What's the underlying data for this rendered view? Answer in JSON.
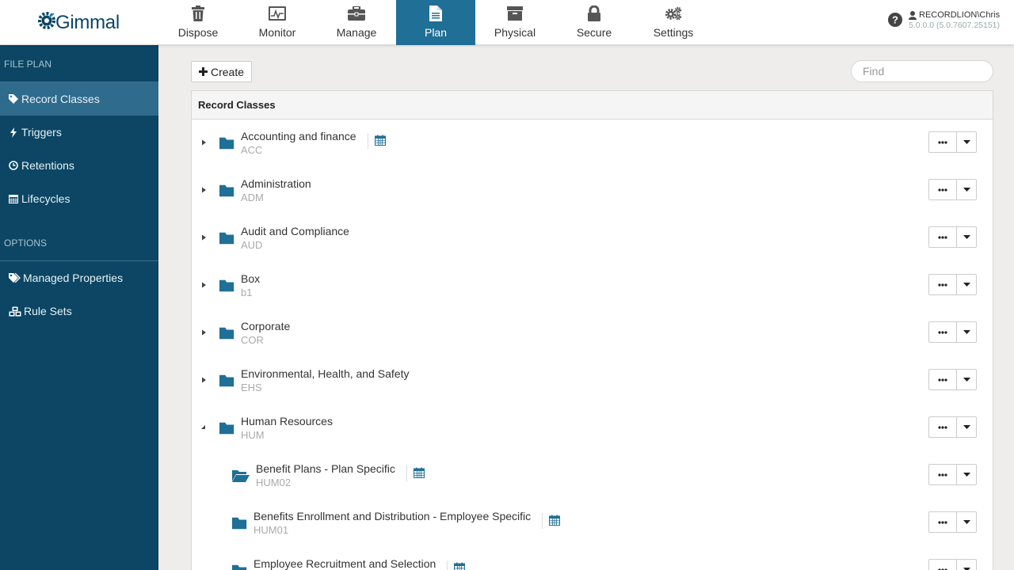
{
  "brand": {
    "name": "Gimmal"
  },
  "nav": [
    {
      "label": "Dispose",
      "icon": "trash-icon"
    },
    {
      "label": "Monitor",
      "icon": "monitor-icon"
    },
    {
      "label": "Manage",
      "icon": "briefcase-icon"
    },
    {
      "label": "Plan",
      "icon": "document-icon",
      "active": true
    },
    {
      "label": "Physical",
      "icon": "archive-box-icon"
    },
    {
      "label": "Secure",
      "icon": "lock-icon"
    },
    {
      "label": "Settings",
      "icon": "gears-icon"
    }
  ],
  "user": {
    "name": "RECORDLION\\Chris",
    "version": "5.0.0.0 (5.0.7607.25151)"
  },
  "sidebar": {
    "file_plan_heading": "FILE PLAN",
    "options_heading": "OPTIONS",
    "items": [
      {
        "label": "Record Classes",
        "icon": "tag-icon",
        "active": true
      },
      {
        "label": "Triggers",
        "icon": "bolt-icon"
      },
      {
        "label": "Retentions",
        "icon": "clock-icon"
      },
      {
        "label": "Lifecycles",
        "icon": "calendar-icon"
      },
      {
        "label": "Managed Properties",
        "icon": "tags-icon"
      },
      {
        "label": "Rule Sets",
        "icon": "cubes-icon"
      }
    ]
  },
  "toolbar": {
    "create_label": "Create",
    "find_placeholder": "Find"
  },
  "panel": {
    "title": "Record Classes"
  },
  "record_classes": [
    {
      "name": "Accounting and finance",
      "code": "ACC",
      "expanded": false,
      "has_calendar": true,
      "level": 0
    },
    {
      "name": "Administration",
      "code": "ADM",
      "expanded": false,
      "has_calendar": false,
      "level": 0
    },
    {
      "name": "Audit and Compliance",
      "code": "AUD",
      "expanded": false,
      "has_calendar": false,
      "level": 0
    },
    {
      "name": "Box",
      "code": "b1",
      "expanded": false,
      "has_calendar": false,
      "level": 0
    },
    {
      "name": "Corporate",
      "code": "COR",
      "expanded": false,
      "has_calendar": false,
      "level": 0
    },
    {
      "name": "Environmental, Health, and Safety",
      "code": "EHS",
      "expanded": false,
      "has_calendar": false,
      "level": 0
    },
    {
      "name": "Human Resources",
      "code": "HUM",
      "expanded": true,
      "has_calendar": false,
      "level": 0
    },
    {
      "name": "Benefit Plans - Plan Specific",
      "code": "HUM02",
      "expanded": false,
      "has_calendar": true,
      "level": 1,
      "open_folder": true
    },
    {
      "name": "Benefits Enrollment and Distribution - Employee Specific",
      "code": "HUM01",
      "expanded": false,
      "has_calendar": true,
      "level": 1
    },
    {
      "name": "Employee Recruitment and Selection",
      "code": "",
      "expanded": false,
      "has_calendar": true,
      "level": 1
    }
  ],
  "colors": {
    "accent": "#1f6f96",
    "sidebar": "#0c4664",
    "folder": "#1f6f96"
  }
}
